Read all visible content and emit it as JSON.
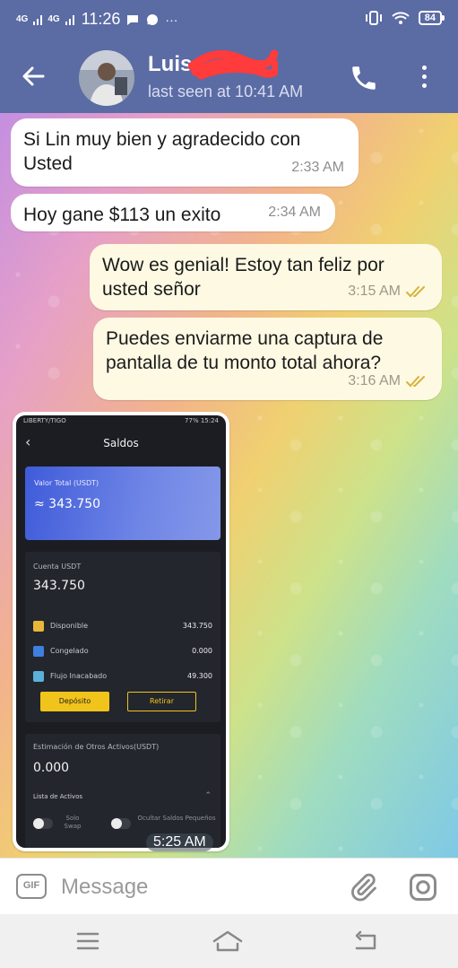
{
  "status_bar": {
    "network_1": "4G",
    "network_2": "4G",
    "time": "11:26",
    "overflow": "···",
    "battery": "84",
    "icons": [
      "signal-icon",
      "chat-bubble-icon",
      "vibrate-icon",
      "wifi-icon",
      "battery-icon"
    ]
  },
  "header": {
    "contact_name": "Luis",
    "last_seen": "last seen at 10:41 AM",
    "icons": [
      "back-arrow-icon",
      "avatar",
      "phone-icon",
      "more-vert-icon"
    ]
  },
  "messages": [
    {
      "direction": "in",
      "text": "Si Lin muy bien y agradecido con Usted",
      "time": "2:33 AM"
    },
    {
      "direction": "in",
      "text": "Hoy gane $113  un exito",
      "time": "2:34 AM"
    },
    {
      "direction": "out",
      "text": "Wow es genial! Estoy tan feliz por usted señor",
      "time": "3:15 AM",
      "read": true
    },
    {
      "direction": "out",
      "text": "Puedes enviarme una captura de pantalla de tu monto total ahora?",
      "time": "3:16 AM",
      "read": true
    },
    {
      "direction": "in",
      "type": "image",
      "time": "5:25 AM"
    }
  ],
  "screenshot": {
    "status_left": "LIBERTY/TIGO",
    "status_right": "77% 15:24",
    "title": "Saldos",
    "total_label": "Valor Total (USDT)",
    "total_value": "≈ 343.750",
    "account_label": "Cuenta USDT",
    "account_value": "343.750",
    "rows": [
      {
        "label": "Disponible",
        "value": "343.750",
        "icon_color": "#e8b73a"
      },
      {
        "label": "Congelado",
        "value": "0.000",
        "icon_color": "#3f7fe0"
      },
      {
        "label": "Flujo Inacabado",
        "value": "49.300",
        "icon_color": "#5bb0d8"
      }
    ],
    "deposit_label": "Depósito",
    "withdraw_label": "Retirar",
    "other_label": "Estimación de Otros Activos(USDT)",
    "other_value": "0.000",
    "assets_label": "Lista de Activos",
    "toggle_1": "Solo Swap",
    "toggle_2": "Ocultar Saldos Pequeños"
  },
  "composer": {
    "gif_label": "GIF",
    "placeholder": "Message"
  },
  "colors": {
    "header": "#5b6ba4",
    "incoming_bubble": "#ffffff",
    "outgoing_bubble": "#fdf9e3",
    "read_ticks": "#d9b23a"
  }
}
